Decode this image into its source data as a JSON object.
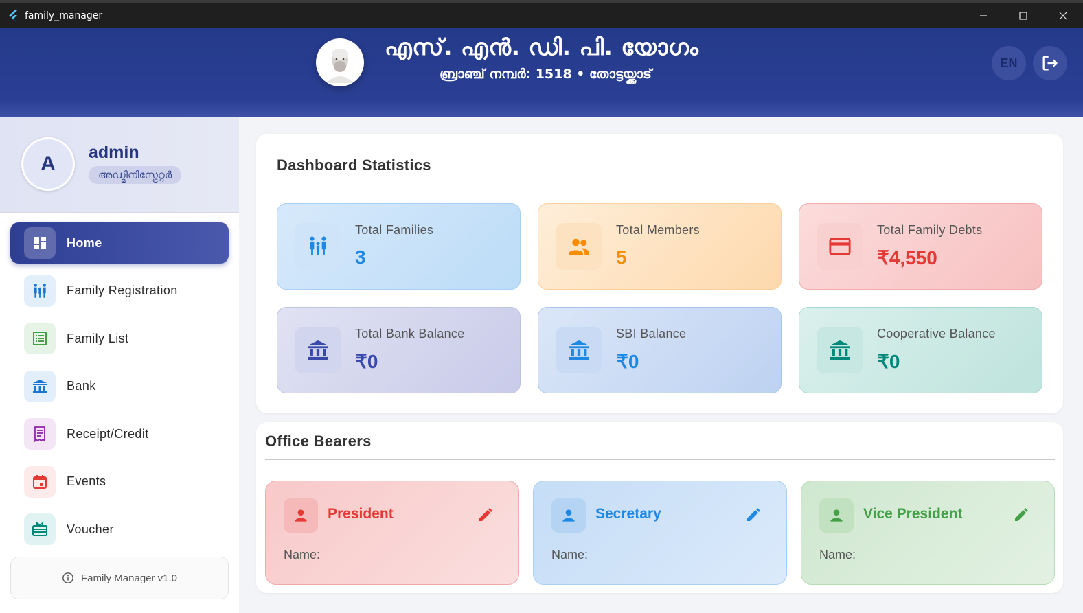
{
  "window": {
    "title": "family_manager"
  },
  "header": {
    "title": "എസ്. എൻ. ഡി. പി. യോഗം",
    "subtitle": "ബ്രാഞ്ച് നമ്പർ: 1518 • തോട്ടയ്ക്കാട്",
    "lang_label": "EN"
  },
  "profile": {
    "initial": "A",
    "name": "admin",
    "role": "അഡ്മിനിസ്ട്രേറ്റർ"
  },
  "nav": [
    {
      "label": "Home",
      "icon": "dashboard-icon",
      "active": true
    },
    {
      "label": "Family Registration",
      "icon": "family-icon",
      "color": "#1976d2"
    },
    {
      "label": "Family List",
      "icon": "list-icon",
      "color": "#43a047"
    },
    {
      "label": "Bank",
      "icon": "bank-icon",
      "color": "#1976d2"
    },
    {
      "label": "Receipt/Credit",
      "icon": "receipt-icon",
      "color": "#8e24aa"
    },
    {
      "label": "Events",
      "icon": "calendar-icon",
      "color": "#e53935"
    },
    {
      "label": "Voucher",
      "icon": "voucher-icon",
      "color": "#00897b"
    }
  ],
  "version": "Family Manager v1.0",
  "stats": {
    "title": "Dashboard Statistics",
    "items": [
      {
        "label": "Total Families",
        "value": "3",
        "icon": "family-icon",
        "color": "#1e88e5"
      },
      {
        "label": "Total Members",
        "value": "5",
        "icon": "group-icon",
        "color": "#fb8c00"
      },
      {
        "label": "Total Family Debts",
        "value": "₹4,550",
        "icon": "credit-card-icon",
        "color": "#e53935"
      },
      {
        "label": "Total Bank Balance",
        "value": "₹0",
        "icon": "bank-icon",
        "color": "#3949ab"
      },
      {
        "label": "SBI Balance",
        "value": "₹0",
        "icon": "bank-icon",
        "color": "#1e88e5"
      },
      {
        "label": "Cooperative Balance",
        "value": "₹0",
        "icon": "bank-icon",
        "color": "#00897b"
      }
    ]
  },
  "bearers": {
    "title": "Office Bearers",
    "items": [
      {
        "title": "President",
        "name_label": "Name:",
        "color": "#e53935"
      },
      {
        "title": "Secretary",
        "name_label": "Name:",
        "color": "#1e88e5"
      },
      {
        "title": "Vice President",
        "name_label": "Name:",
        "color": "#43a047"
      }
    ]
  }
}
